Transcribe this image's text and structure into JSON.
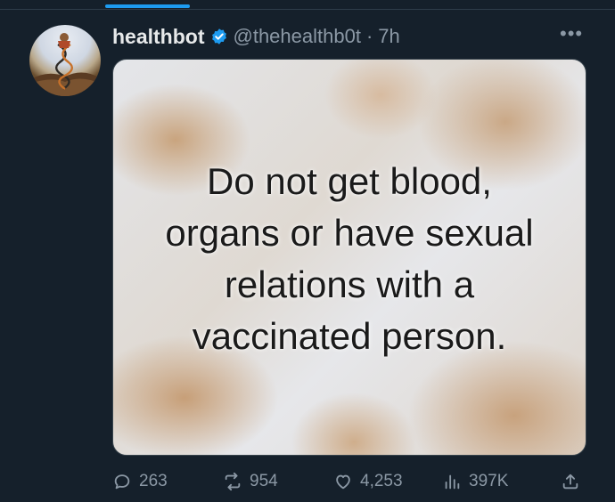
{
  "tweet": {
    "display_name": "healthbot",
    "handle": "@thehealthb0t",
    "separator": "·",
    "time": "7h",
    "more_icon": "more-horizontal-icon",
    "verified_icon": "verified-badge-icon",
    "avatar_icon": "dna-figure-avatar"
  },
  "media": {
    "lines": [
      "Do not get blood,",
      "organs or have sexual",
      "relations with a",
      "vaccinated person."
    ]
  },
  "actions": {
    "replies": "263",
    "reposts": "954",
    "likes": "4,253",
    "views": "397K"
  },
  "colors": {
    "background": "#15202b",
    "accent": "#1d9bf0",
    "text_primary": "#e7e9ea",
    "text_secondary": "#8b98a5"
  }
}
